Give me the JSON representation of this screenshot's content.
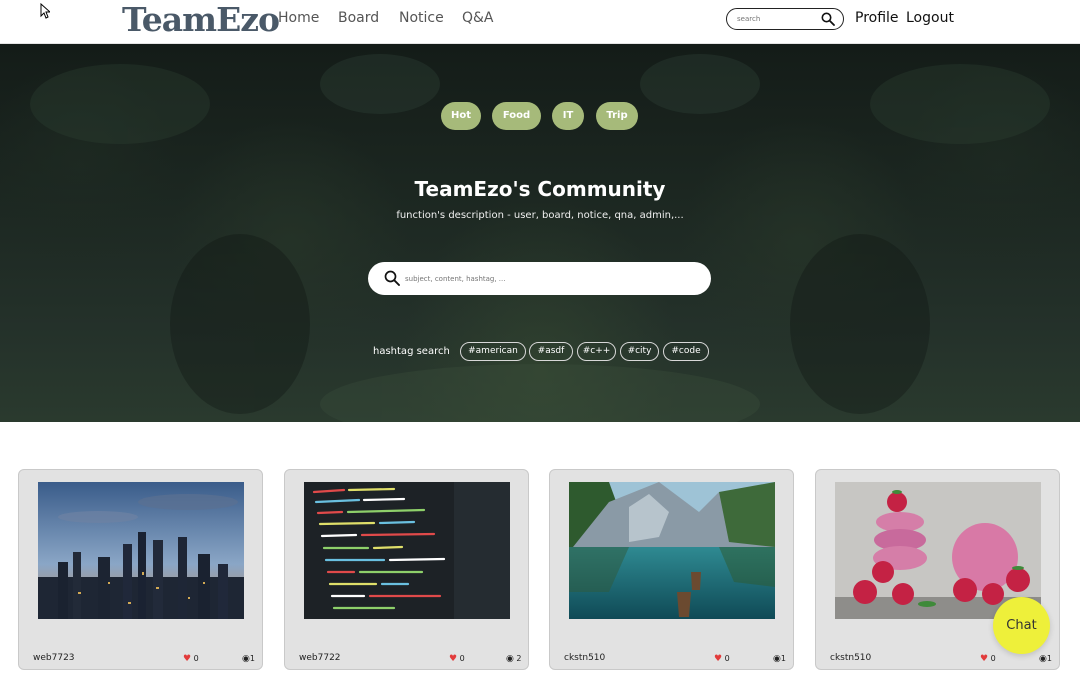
{
  "header": {
    "logo": "TeamEzo",
    "nav": [
      "Home",
      "Board",
      "Notice",
      "Q&A"
    ],
    "search_placeholder": "search",
    "profile": "Profile",
    "logout": "Logout"
  },
  "hero": {
    "categories": [
      "Hot",
      "Food",
      "IT",
      "Trip"
    ],
    "title": "TeamEzo's Community",
    "description": "function's description - user, board, notice, qna, admin,...",
    "search_placeholder": "subject, content, hashtag, ...",
    "hashtag_label": "hashtag search",
    "hashtags": [
      "#american",
      "#asdf",
      "#c++",
      "#city",
      "#code"
    ]
  },
  "cards": [
    {
      "user": "web7723",
      "likes": "0",
      "views": "1",
      "image": "city-skyline-dusk"
    },
    {
      "user": "web7722",
      "likes": "0",
      "views": "2",
      "image": "code-screen"
    },
    {
      "user": "ckstn510",
      "likes": "0",
      "views": "1",
      "image": "mountain-lake-boats"
    },
    {
      "user": "ckstn510",
      "likes": "0",
      "views": "1",
      "image": "macarons-raspberries"
    }
  ],
  "chat": {
    "label": "Chat"
  },
  "colors": {
    "accent_pill": "#a6ba7a",
    "chat": "#eef03a",
    "heart": "#e23b3b"
  }
}
